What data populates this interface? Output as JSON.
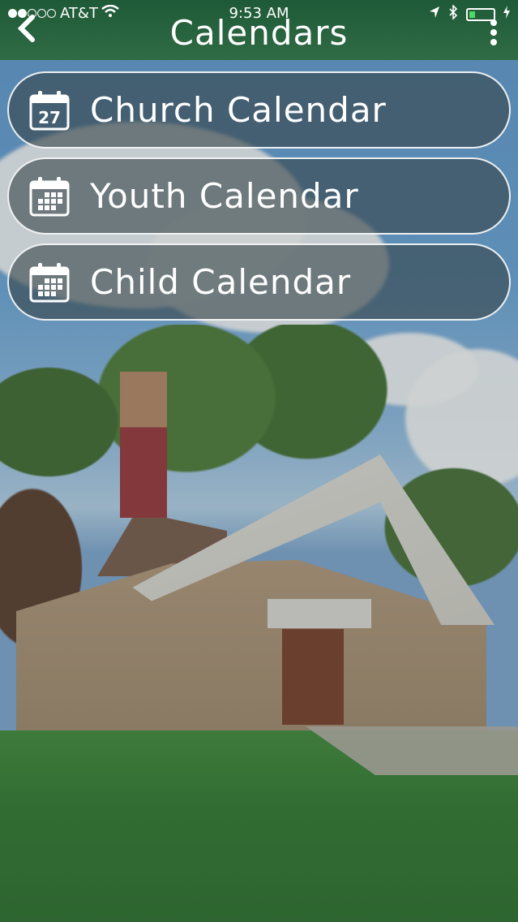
{
  "status": {
    "carrier": "AT&T",
    "time": "9:53 AM"
  },
  "header": {
    "title": "Calendars"
  },
  "calendars": [
    {
      "label": "Church Calendar",
      "icon": "calendar-date-icon",
      "icon_text": "27"
    },
    {
      "label": "Youth Calendar",
      "icon": "calendar-grid-icon"
    },
    {
      "label": "Child Calendar",
      "icon": "calendar-grid-icon"
    }
  ],
  "colors": {
    "header": "#2f6b44",
    "button_bg": "#37464b",
    "button_border": "#ffffff"
  }
}
